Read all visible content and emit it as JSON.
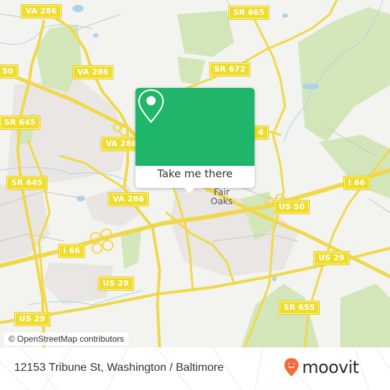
{
  "map": {
    "road_labels": [
      {
        "id": "va286-top",
        "text": "VA 286"
      },
      {
        "id": "sr665",
        "text": "SR 665"
      },
      {
        "id": "us50-left",
        "text": "50"
      },
      {
        "id": "va286-mid",
        "text": "VA 286"
      },
      {
        "id": "sr672",
        "text": "SR 672"
      },
      {
        "id": "sr645-top",
        "text": "SR 645"
      },
      {
        "id": "va286-low",
        "text": "VA 286"
      },
      {
        "id": "sr674",
        "text": "4"
      },
      {
        "id": "sr645-mid",
        "text": "SR 645"
      },
      {
        "id": "va286-bot",
        "text": "VA 286"
      },
      {
        "id": "i66-right",
        "text": "I 66"
      },
      {
        "id": "us50-right",
        "text": "US 50"
      },
      {
        "id": "i66-left",
        "text": "I 66"
      },
      {
        "id": "us29-right",
        "text": "US 29"
      },
      {
        "id": "us29-mid",
        "text": "US 29"
      },
      {
        "id": "us29-left",
        "text": "US 29"
      },
      {
        "id": "sr655",
        "text": "SR 655"
      }
    ],
    "place_label": "Fair\nOaks",
    "place_line1": "Fair",
    "place_line2": "Oaks",
    "attribution": "© OpenStreetMap contributors"
  },
  "popup": {
    "icon": "map-pin-icon",
    "button_label": "Take me there",
    "accent_color": "#1fb56a"
  },
  "footer": {
    "address": "12153 Tribune St, Washington / Baltimore",
    "brand": "moovit",
    "brand_color": "#f26b3a"
  }
}
